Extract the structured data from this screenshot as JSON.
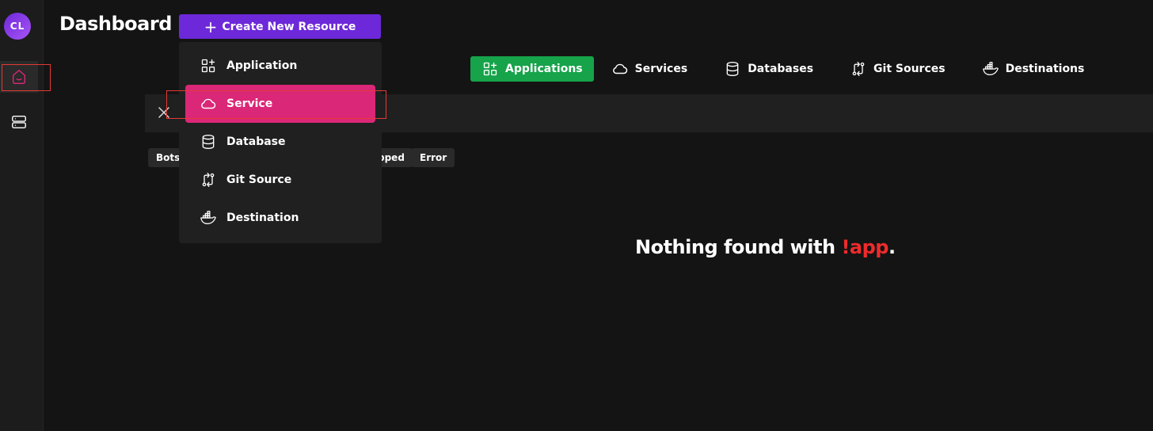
{
  "sidebar": {
    "avatar_initials": "CL",
    "items": [
      {
        "name": "home",
        "icon": "home-icon",
        "active": true
      },
      {
        "name": "servers",
        "icon": "server-icon",
        "active": false
      }
    ]
  },
  "header": {
    "title": "Dashboard",
    "create_button_label": "Create New Resource"
  },
  "create_menu": {
    "items": [
      {
        "label": "Application",
        "icon": "grid-plus-icon",
        "highlighted": false
      },
      {
        "label": "Service",
        "icon": "cloud-icon",
        "highlighted": true
      },
      {
        "label": "Database",
        "icon": "database-icon",
        "highlighted": false
      },
      {
        "label": "Git Source",
        "icon": "git-compare-icon",
        "highlighted": false
      },
      {
        "label": "Destination",
        "icon": "docker-icon",
        "highlighted": false
      }
    ]
  },
  "tabs": [
    {
      "label": "Applications",
      "icon": "grid-plus-icon",
      "active": true
    },
    {
      "label": "Services",
      "icon": "cloud-icon",
      "active": false
    },
    {
      "label": "Databases",
      "icon": "database-icon",
      "active": false
    },
    {
      "label": "Git Sources",
      "icon": "git-compare-icon",
      "active": false
    },
    {
      "label": "Destinations",
      "icon": "docker-icon",
      "active": false
    }
  ],
  "filters": {
    "chips": [
      "Bots",
      "pped",
      "Error"
    ]
  },
  "empty_state": {
    "prefix": "Nothing found with ",
    "query": "!app",
    "suffix": "."
  },
  "colors": {
    "background": "#141414",
    "accent_purple": "#6d28d9",
    "accent_pink": "#db2777",
    "accent_green": "#16a34a",
    "query_red": "#ef2b2b"
  }
}
